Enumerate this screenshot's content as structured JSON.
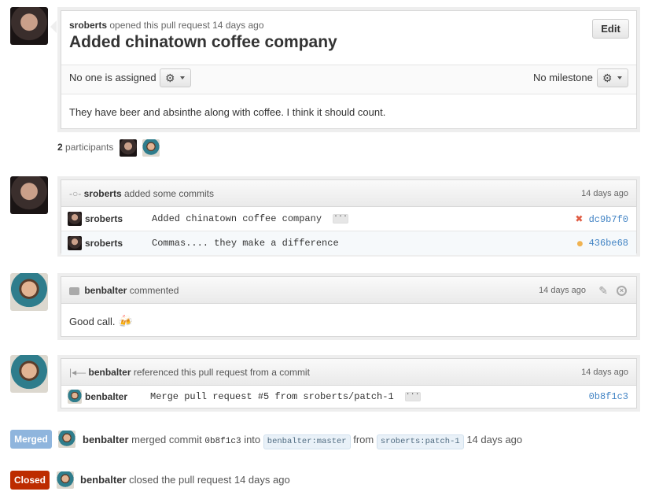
{
  "opening": {
    "author": "sroberts",
    "action": "opened this pull request 14 days ago",
    "title": "Added chinatown coffee company",
    "edit_label": "Edit",
    "assignee_text": "No one is assigned",
    "milestone_text": "No milestone",
    "body": "They have beer and absinthe along with coffee. I think it should count."
  },
  "participants": {
    "count": "2",
    "label": "participants"
  },
  "commits_event": {
    "author": "sroberts",
    "action": "added some commits",
    "time": "14 days ago",
    "commits": [
      {
        "author": "sroberts",
        "message": "Added chinatown coffee company",
        "sha": "dc9b7f0",
        "status": "failure",
        "status_glyph": "✖",
        "status_color": "#e05d44"
      },
      {
        "author": "sroberts",
        "message": "Commas.... they make a difference",
        "sha": "436be68",
        "status": "pending",
        "status_glyph": "●",
        "status_color": "#f0b352"
      }
    ]
  },
  "comment": {
    "author": "benbalter",
    "action": "commented",
    "time": "14 days ago",
    "body": "Good call.",
    "emoji": "🍻"
  },
  "reference": {
    "author": "benbalter",
    "action": "referenced this pull request from a commit",
    "time": "14 days ago",
    "commit": {
      "author": "benbalter",
      "message": "Merge pull request #5 from sroberts/patch-1",
      "sha": "0b8f1c3"
    }
  },
  "merged": {
    "badge": "Merged",
    "badge_color": "#6cc644",
    "author": "benbalter",
    "action": "merged commit",
    "sha": "0b8f1c3",
    "into": "into",
    "base": "benbalter:master",
    "from": "from",
    "head": "sroberts:patch-1",
    "time": "14 days ago"
  },
  "closed": {
    "badge": "Closed",
    "badge_color": "#bd2c00",
    "author": "benbalter",
    "action": "closed the pull request 14 days ago"
  },
  "colors": {
    "link": "#4183c4",
    "merged_badge": "#8fb5dd",
    "closed_badge": "#bd2c00"
  },
  "icons": {
    "gear": "gear-icon",
    "commit": "git-commit-icon",
    "comment": "comment-icon",
    "reference": "cross-reference-icon",
    "pencil": "pencil-icon",
    "delete": "close-circle-icon"
  }
}
